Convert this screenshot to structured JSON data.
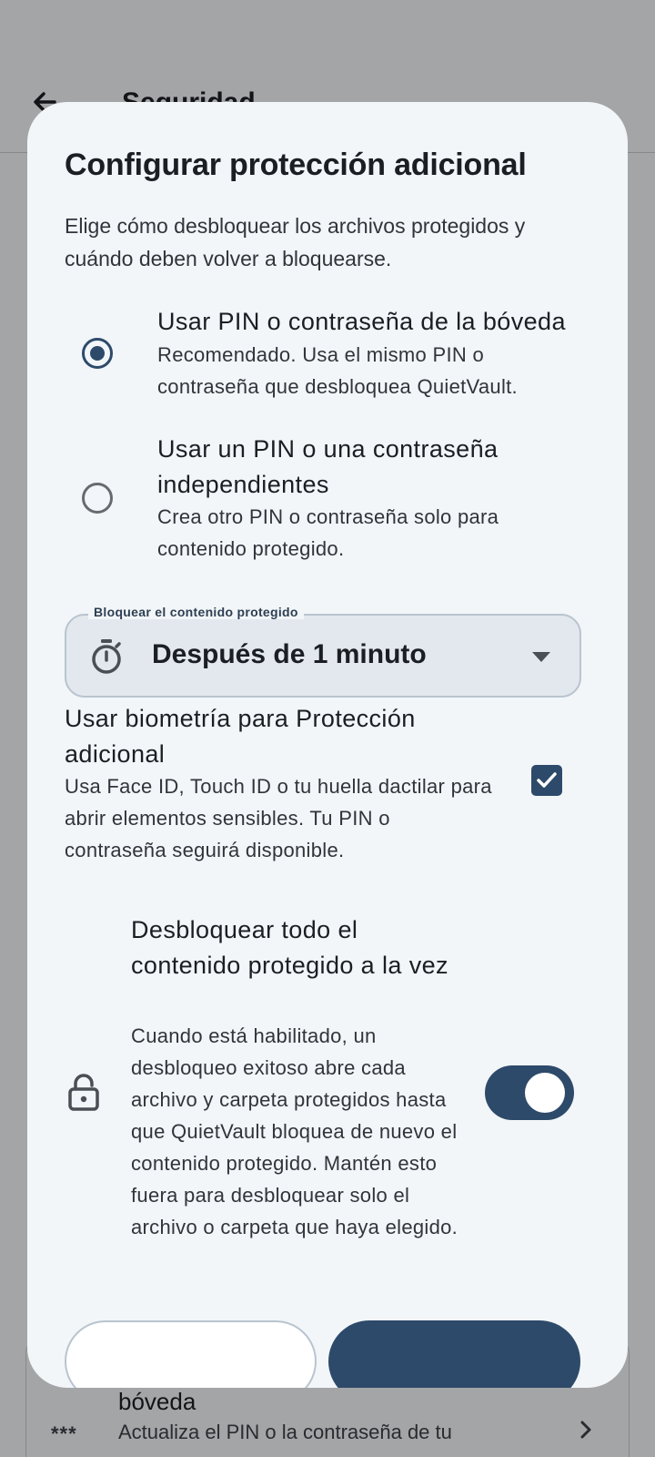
{
  "background": {
    "appbar_title": "Seguridad",
    "item_title": "bóveda",
    "item_subtitle": "Actualiza el PIN o la contraseña de tu",
    "item_icon_text": "***"
  },
  "dialog": {
    "title": "Configurar protección adicional",
    "description": "Elige cómo desbloquear los archivos protegidos y cuándo deben volver a bloquearse.",
    "options": [
      {
        "title": "Usar PIN o contraseña de la bóveda",
        "subtitle": "Recomendado. Usa el mismo PIN o contraseña que desbloquea QuietVault.",
        "selected": true
      },
      {
        "title": "Usar un PIN o una contraseña independientes",
        "subtitle": "Crea otro PIN o contraseña solo para contenido protegido.",
        "selected": false
      }
    ],
    "lock_dropdown": {
      "label": "Bloquear el contenido protegido",
      "value": "Después de 1 minuto",
      "icon": "timer-icon"
    },
    "biometrics": {
      "title": "Usar biometría para Protección adicional",
      "subtitle": "Usa Face ID, Touch ID o tu huella dactilar para abrir elementos sensibles. Tu PIN o contraseña seguirá disponible.",
      "checked": true
    },
    "unlock_all": {
      "title": "Desbloquear todo el contenido protegido a la vez",
      "subtitle": "Cuando está habilitado, un desbloqueo exitoso abre cada archivo y carpeta protegidos hasta que QuietVault bloquea de nuevo el contenido protegido. Mantén esto fuera para desbloquear solo el archivo o carpeta que haya elegido.",
      "enabled": true,
      "icon": "lock-icon"
    }
  },
  "colors": {
    "primary": "#2e4a6a",
    "dialog_bg": "#f2f6f9",
    "scrim": "#a3a5a7"
  }
}
